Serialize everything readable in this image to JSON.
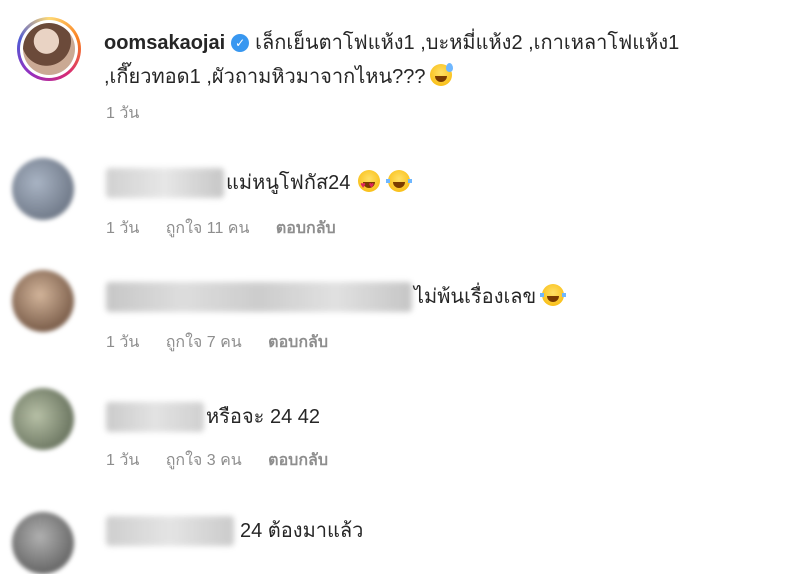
{
  "post": {
    "username": "oomsakaojai",
    "verified": true,
    "caption_line1": "เล็กเย็นตาโฟแห้ง1 ,บะหมี่แห้ง2 ,เกาเหลาโฟแห้ง1",
    "caption_line2": ",เกี๊ยวทอด1 ,ผัวถามหิวมาจากไหน???",
    "caption_emoji": "grinning-sweat-emoji",
    "time": "1 วัน"
  },
  "comments": [
    {
      "text": "แม่หนูโฟกัส24",
      "emojis": [
        "heart-eyes-emoji",
        "laughing-tears-emoji"
      ],
      "time": "1 วัน",
      "likes": "ถูกใจ 11 คน",
      "reply": "ตอบกลับ"
    },
    {
      "text": "ไม่พ้นเรื่องเลข",
      "emojis": [
        "laughing-tears-emoji"
      ],
      "time": "1 วัน",
      "likes": "ถูกใจ 7 คน",
      "reply": "ตอบกลับ"
    },
    {
      "text": "หรือจะ 24 42",
      "emojis": [],
      "time": "1 วัน",
      "likes": "ถูกใจ 3 คน",
      "reply": "ตอบกลับ"
    },
    {
      "text": "24 ต้องมาแล้ว",
      "emojis": [],
      "time": "",
      "likes": "",
      "reply": ""
    }
  ],
  "colors": {
    "text": "#262626",
    "meta": "#8e8e8e",
    "verified": "#3897f0"
  }
}
